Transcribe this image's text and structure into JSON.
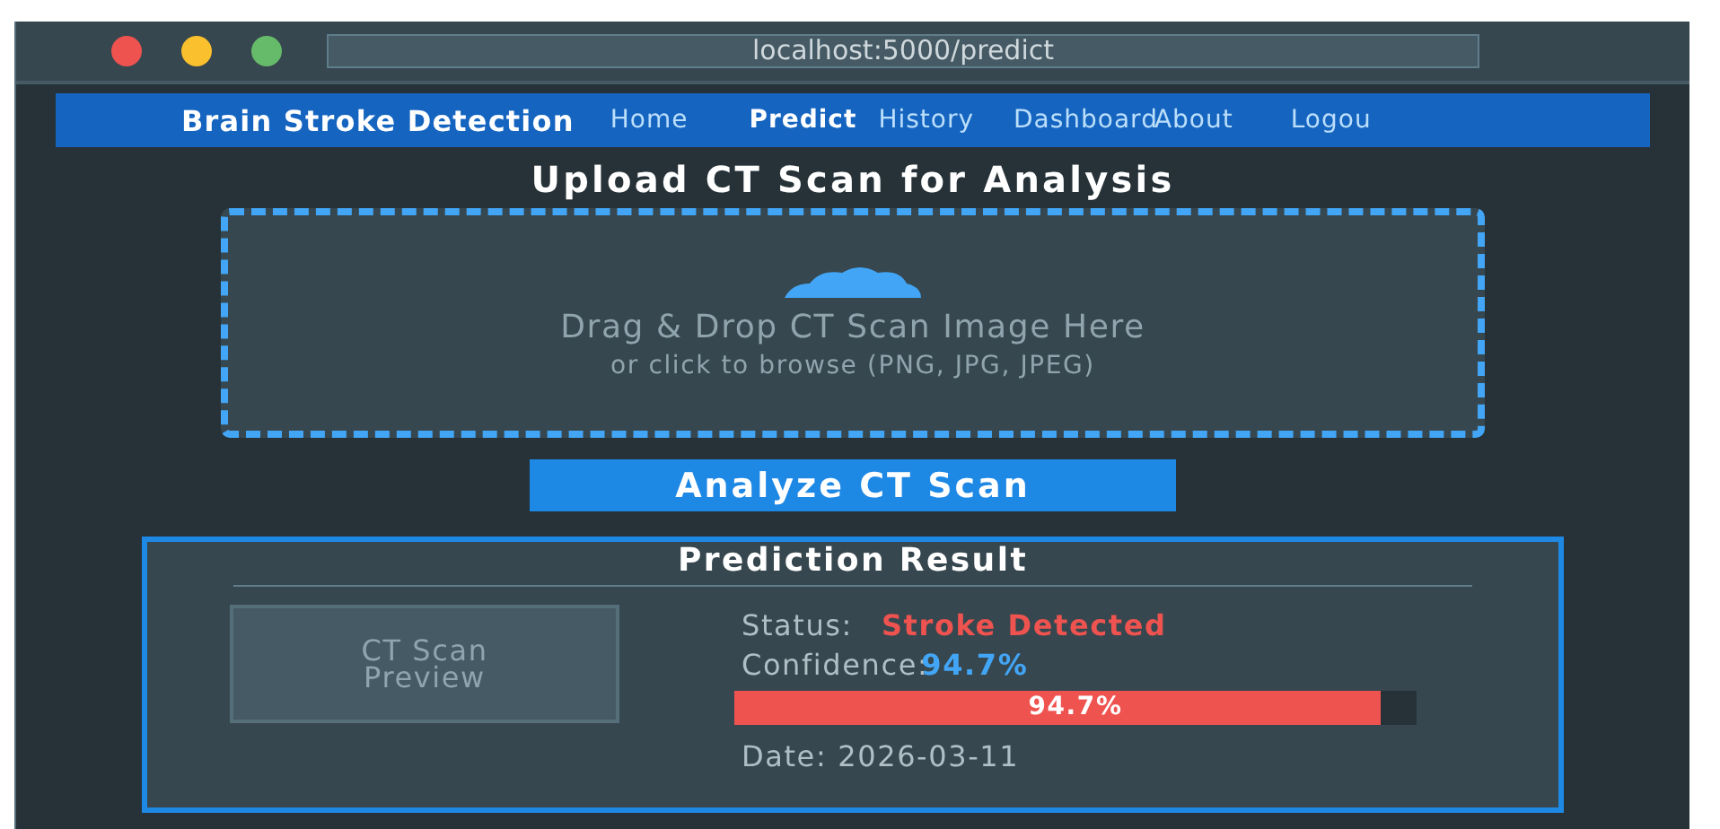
{
  "browser": {
    "url": "localhost:5000/predict"
  },
  "nav": {
    "brand": "Brain Stroke Detection",
    "items": [
      {
        "label": "Home",
        "selected": false
      },
      {
        "label": "Predict",
        "selected": true
      },
      {
        "label": "History",
        "selected": false
      },
      {
        "label": "Dashboard",
        "selected": false
      },
      {
        "label": "About",
        "selected": false
      },
      {
        "label": "Logou",
        "selected": false
      }
    ]
  },
  "upload": {
    "heading": "Upload CT Scan for Analysis",
    "drop_text": "Drag & Drop CT Scan Image Here",
    "hint": "or click to browse (PNG, JPG, JPEG)",
    "button": "Analyze CT Scan"
  },
  "result": {
    "title": "Prediction Result",
    "preview": "CT Scan Preview",
    "status_label": "Status:",
    "status": "Stroke Detected",
    "stroke": true,
    "confidence_label": "Confidence:",
    "confidence": "94.7%",
    "level": 0.947,
    "bar_text": "94.7%",
    "date_label": "Date:",
    "date": "2026-03-11"
  }
}
